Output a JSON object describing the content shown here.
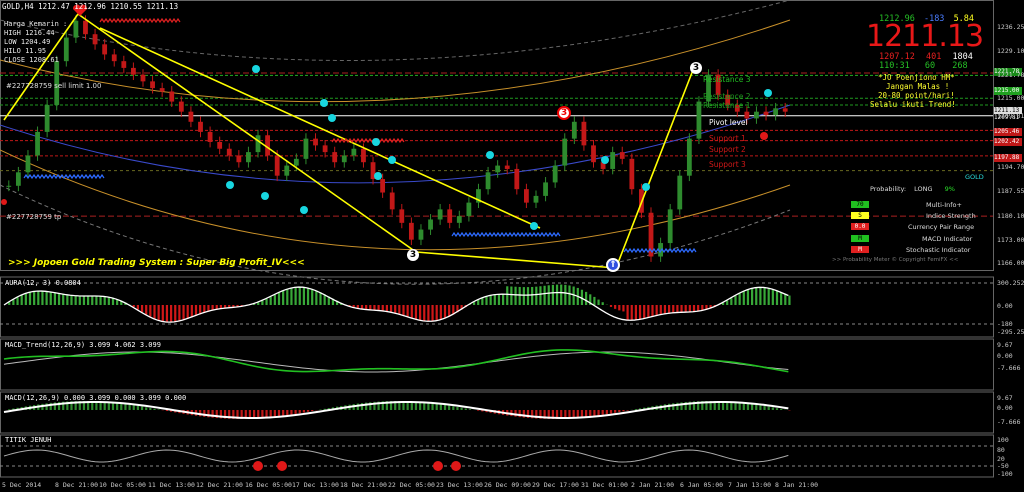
{
  "window_title": "GOLD,H4",
  "ohlc_header": [
    "1212.47",
    "1212.96",
    "1210.55",
    "1211.13"
  ],
  "info_lines": [
    "Harga Kemarin :",
    "HIGH 1216.44",
    "LOW 1204.49",
    "HILO 11.95",
    "CLOSE 1208.61"
  ],
  "order_labels": {
    "sell": "#227728759 sell limit 1.00",
    "tp": "#227728759 tp"
  },
  "big_price": "1211.13",
  "quote_grid": [
    [
      {
        "t": "1212.96",
        "c": "#26c026"
      },
      {
        "t": "-183",
        "c": "#4a7dff"
      },
      {
        "t": "5.84",
        "c": "#ffff20"
      }
    ],
    [
      {
        "t": "1207.12",
        "c": "#e82020"
      },
      {
        "t": "401",
        "c": "#e82020"
      },
      {
        "t": "1804",
        "c": "#ffffff"
      }
    ],
    [
      {
        "t": "110:31",
        "c": "#26c026"
      },
      {
        "t": "60",
        "c": "#26c026"
      },
      {
        "t": "268",
        "c": "#26c026"
      }
    ]
  ],
  "promo_lines": [
    "*JO Poenjiono HM*",
    "Jangan Malas !",
    "20-80 point/hari!",
    "Selalu ikuti Trend!"
  ],
  "banner": ">>> Jopoen Gold Trading System : Super Big Profit_IV<<<",
  "levels": {
    "r3": "Resistance 3",
    "r2": "Resistance 2",
    "r1": "Resistance 1",
    "pivot": "Pivot level",
    "s1": "Support 1",
    "s2": "Support 2",
    "s3": "Support 3"
  },
  "side_panel": {
    "symbol": "GOLD",
    "probability_label": "Probability:",
    "probability_dir": "LONG",
    "probability_val": "9%",
    "rows": [
      {
        "badge": "70",
        "badge_color": "#20c020",
        "label": "Multi-Info+"
      },
      {
        "badge": "S",
        "badge_color": "#ffff20",
        "label": "Indice Strength"
      },
      {
        "badge": "0.0",
        "badge_color": "#e02020",
        "label": "Currency Pair Range"
      },
      {
        "badge": "M",
        "badge_color": "#20c020",
        "label": "MACD Indicator"
      },
      {
        "badge": "M",
        "badge_color": "#e02020",
        "label": "Stochastic Indicator"
      }
    ],
    "footer": ">> Probability Meter © Copyright FemiFX <<"
  },
  "price_tags": [
    {
      "t": "1221.78",
      "c": "#188a18"
    },
    {
      "t": "1215.00",
      "c": "#1fa01f"
    },
    {
      "t": "1211.13",
      "c": "#e0e0e0"
    },
    {
      "t": "1209.81",
      "c": "#000000"
    },
    {
      "t": "1205.46",
      "c": "#c01818"
    },
    {
      "t": "1202.42",
      "c": "#c01818"
    },
    {
      "t": "1197.88",
      "c": "#c01818"
    }
  ],
  "subpanels": [
    {
      "title": "AURA(12, 3) 0.0804",
      "axis": [
        "300.2523",
        "0.00",
        "-180",
        "-295.252"
      ]
    },
    {
      "title": "MACD_Trend(12,26,9) 3.099 4.062 3.099",
      "axis": [
        "9.67",
        "0.00",
        "-7.666"
      ]
    },
    {
      "title": "MACD(12,26,9) 0.000 3.099 0.000 3.099 0.000",
      "axis": [
        "9.67",
        "0.00",
        "-7.666"
      ]
    },
    {
      "title": "TITIK JENUH",
      "axis": [
        "100",
        "80",
        "20",
        "-50",
        "-100"
      ]
    }
  ],
  "chart_data": {
    "type": "candlestick",
    "symbol": "GOLD",
    "timeframe": "H4",
    "y_ticks": [
      "1236.25",
      "1229.10",
      "1221.78",
      "1215.00",
      "1209.81",
      "1194.70",
      "1187.55",
      "1180.10",
      "1173.00",
      "1166.00"
    ],
    "ylim": [
      1164.0,
      1240.0
    ],
    "x_ticks": [
      "5 Dec 2014",
      "8 Dec 21:00",
      "10 Dec 05:00",
      "11 Dec 13:00",
      "12 Dec 21:00",
      "16 Dec 05:00",
      "17 Dec 13:00",
      "18 Dec 21:00",
      "22 Dec 05:00",
      "23 Dec 13:00",
      "26 Dec 09:00",
      "29 Dec 17:00",
      "31 Dec 01:00",
      "2 Jan 21:00",
      "6 Jan 05:00",
      "7 Jan 13:00",
      "8 Jan 21:00"
    ],
    "close_path": [
      1189,
      1193,
      1198,
      1205,
      1213,
      1226,
      1233,
      1238,
      1234,
      1231,
      1228,
      1226,
      1224,
      1222,
      1220,
      1218,
      1217,
      1214,
      1211,
      1208,
      1205,
      1202,
      1200,
      1198,
      1196,
      1199,
      1204,
      1198,
      1192,
      1195,
      1197,
      1203,
      1201,
      1199,
      1196,
      1198,
      1200,
      1196,
      1191,
      1187,
      1182,
      1178,
      1173,
      1176,
      1179,
      1182,
      1178,
      1180,
      1184,
      1188,
      1193,
      1195,
      1194,
      1188,
      1184,
      1186,
      1190,
      1195,
      1203,
      1208,
      1201,
      1196,
      1194,
      1199,
      1197,
      1188,
      1181,
      1168,
      1172,
      1182,
      1192,
      1203,
      1214,
      1222,
      1216,
      1213,
      1211,
      1209,
      1211,
      1210,
      1212,
      1211
    ],
    "pivot_levels": {
      "resistance_3": 1221.78,
      "resistance_2": 1215.0,
      "resistance_1": 1213.0,
      "pivot": 1209.81,
      "support_1": 1205.46,
      "support_2": 1202.42,
      "support_3": 1197.88
    },
    "wave_labels": [
      "3",
      "3",
      "3",
      "3"
    ]
  },
  "colors": {
    "bull": "#2e8b2e",
    "bear": "#c21818",
    "trend": "#ffff00",
    "ma": "#3a4acc",
    "envelope": "#d49a2a"
  }
}
